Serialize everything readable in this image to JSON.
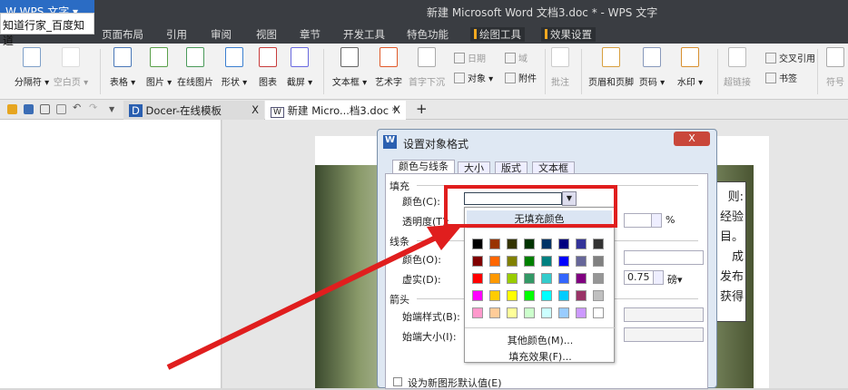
{
  "window": {
    "title": "新建 Microsoft Word 文档3.doc * - WPS 文字",
    "app_button": "W WPS 文字 ▾",
    "tooltip": "知道行家_百度知道"
  },
  "menu": [
    "页面布局",
    "引用",
    "审阅",
    "视图",
    "章节",
    "开发工具",
    "特色功能"
  ],
  "context_menu": [
    "绘图工具",
    "效果设置"
  ],
  "ribbon": [
    {
      "label": "分隔符 ▾"
    },
    {
      "label": "空白页 ▾",
      "disabled": true
    },
    {
      "label": "表格 ▾"
    },
    {
      "label": "图片 ▾"
    },
    {
      "label": "在线图片"
    },
    {
      "label": "形状 ▾"
    },
    {
      "label": "图表"
    },
    {
      "label": "截屏 ▾"
    },
    {
      "label": "文本框 ▾"
    },
    {
      "label": "艺术字"
    },
    {
      "label": "首字下沉",
      "disabled": true
    },
    {
      "label": "批注",
      "disabled": true
    },
    {
      "label": "页眉和页脚"
    },
    {
      "label": "页码 ▾"
    },
    {
      "label": "水印 ▾"
    },
    {
      "label": "超链接",
      "disabled": true
    },
    {
      "label": "符号",
      "disabled": true
    }
  ],
  "ribbon_small": [
    {
      "label": "日期",
      "disabled": true
    },
    {
      "label": "域",
      "disabled": true
    },
    {
      "label": "对象 ▾"
    },
    {
      "label": "附件"
    },
    {
      "label": "交叉引用"
    },
    {
      "label": "书签"
    }
  ],
  "tabs": [
    {
      "label": "Docer-在线模板",
      "close": "X"
    },
    {
      "label": "新建 Micro...档3.doc *",
      "close": "X"
    }
  ],
  "new_tab": "+",
  "doc_text": [
    "则:",
    "经验",
    "目。",
    "成",
    "发布",
    "获得"
  ],
  "dialog": {
    "title": "设置对象格式",
    "close": "X",
    "tabs": [
      "颜色与线条",
      "大小",
      "版式",
      "文本框"
    ],
    "fill_group": "填充",
    "color_label": "颜色(C):",
    "transparency_label": "透明度(T):",
    "transparency_unit": "%",
    "line_group": "线条",
    "line_color_label": "颜色(O):",
    "dash_label": "虚实(D):",
    "weight_value": "0.75",
    "weight_unit": "磅▾",
    "arrow_group": "箭头",
    "begin_style_label": "始端样式(B):",
    "begin_size_label": "始端大小(I):",
    "default_checkbox": "设为新图形默认值(E)"
  },
  "dropdown": {
    "no_fill": "无填充颜色",
    "more_colors": "其他颜色(M)...",
    "fill_effects": "填充效果(F)...",
    "swatches": [
      [
        "#000000",
        "#993300",
        "#333300",
        "#003300",
        "#003366",
        "#000080",
        "#333399",
        "#333333"
      ],
      [
        "#800000",
        "#FF6600",
        "#808000",
        "#008000",
        "#008080",
        "#0000FF",
        "#666699",
        "#808080"
      ],
      [
        "#FF0000",
        "#FF9900",
        "#99CC00",
        "#339966",
        "#33CCCC",
        "#3366FF",
        "#800080",
        "#969696"
      ],
      [
        "#FF00FF",
        "#FFCC00",
        "#FFFF00",
        "#00FF00",
        "#00FFFF",
        "#00CCFF",
        "#993366",
        "#C0C0C0"
      ],
      [
        "#FF99CC",
        "#FFCC99",
        "#FFFF99",
        "#CCFFCC",
        "#CCFFFF",
        "#99CCFF",
        "#CC99FF",
        "#FFFFFF"
      ]
    ]
  },
  "colors": {
    "highlight": "#e01e1e"
  }
}
